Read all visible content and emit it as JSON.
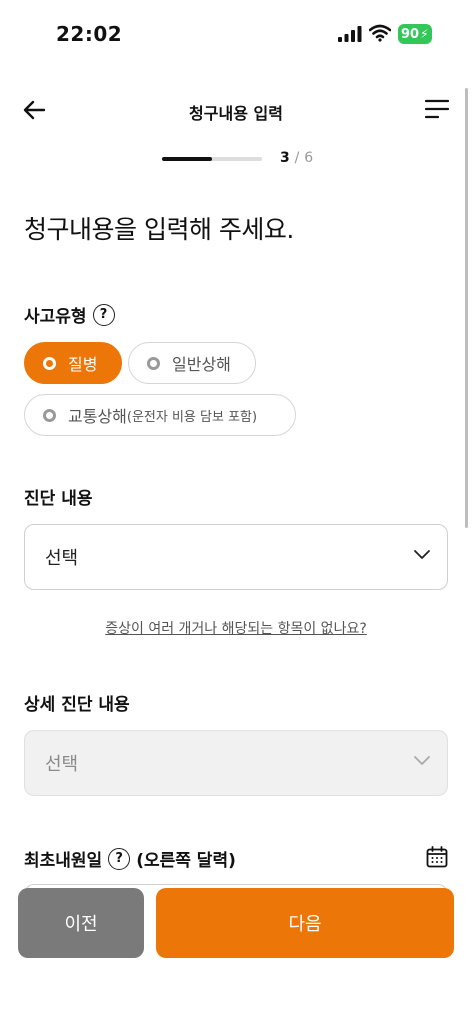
{
  "status_bar": {
    "time": "22:02",
    "battery": "90"
  },
  "header": {
    "title": "청구내용 입력"
  },
  "progress": {
    "current": "3",
    "separator": "/",
    "total": "6",
    "fraction": 0.5
  },
  "heading": "청구내용을 입력해 주세요.",
  "accident_type": {
    "label": "사고유형",
    "help": "?",
    "options": [
      {
        "label": "질병",
        "selected": true
      },
      {
        "label": "일반상해",
        "selected": false
      },
      {
        "label": "교통상해",
        "sub": "(운전자 비용 담보 포함)",
        "selected": false
      }
    ]
  },
  "diagnosis": {
    "label": "진단 내용",
    "value": "선택"
  },
  "help_link": "증상이 여러 개거나 해당되는 항목이 없나요?",
  "detail_diagnosis": {
    "label": "상세 진단 내용",
    "value": "선택"
  },
  "first_visit": {
    "label": "최초내원일",
    "help": "?",
    "hint": "(오른쪽 달력)"
  },
  "buttons": {
    "prev": "이전",
    "next": "다음"
  },
  "colors": {
    "accent": "#ec7608",
    "prev_button": "#7a7a7a",
    "battery": "#33c759"
  }
}
